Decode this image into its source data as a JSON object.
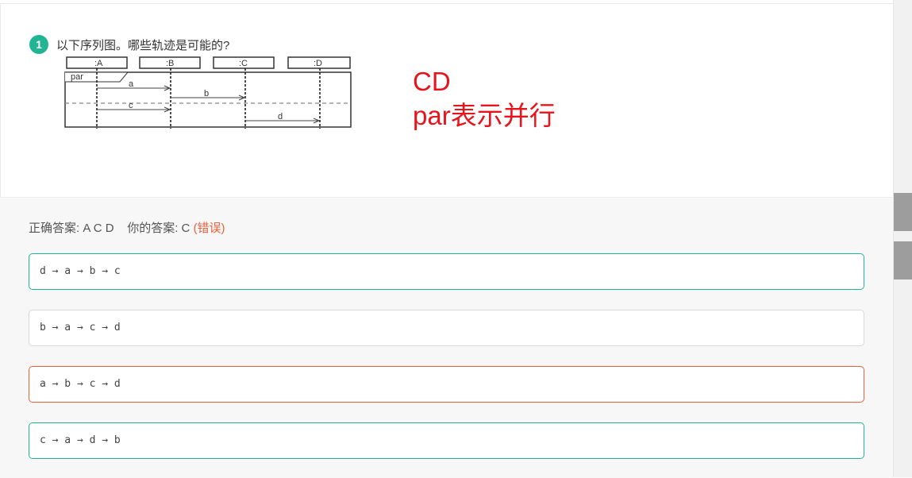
{
  "question": {
    "number": "1",
    "text": "以下序列图。哪些轨迹是可能的?"
  },
  "diagram": {
    "lifelines": [
      ":A",
      ":B",
      ":C",
      ":D"
    ],
    "fragment_label": "par",
    "messages": [
      "a",
      "b",
      "c",
      "d"
    ]
  },
  "annotation": {
    "line1": "CD",
    "line2": "par表示并行"
  },
  "answer_summary": {
    "correct_label": "正确答案:",
    "correct_value": "A C D",
    "yours_label": "你的答案:",
    "yours_value": "C",
    "status": "(错误)"
  },
  "options": [
    {
      "text": "d → a → b → c",
      "state": "correct",
      "border_color": "#21b594"
    },
    {
      "text": "b → a → c → d",
      "state": "neutral",
      "border_color": "#d9d9d9"
    },
    {
      "text": "a → b → c → d",
      "state": "wrong",
      "border_color": "#e8603c"
    },
    {
      "text": "c → a → d → b",
      "state": "correct",
      "border_color": "#21b594"
    }
  ],
  "colors": {
    "accent": "#21b594",
    "error": "#e8603c",
    "annotation": "#e8141c"
  }
}
